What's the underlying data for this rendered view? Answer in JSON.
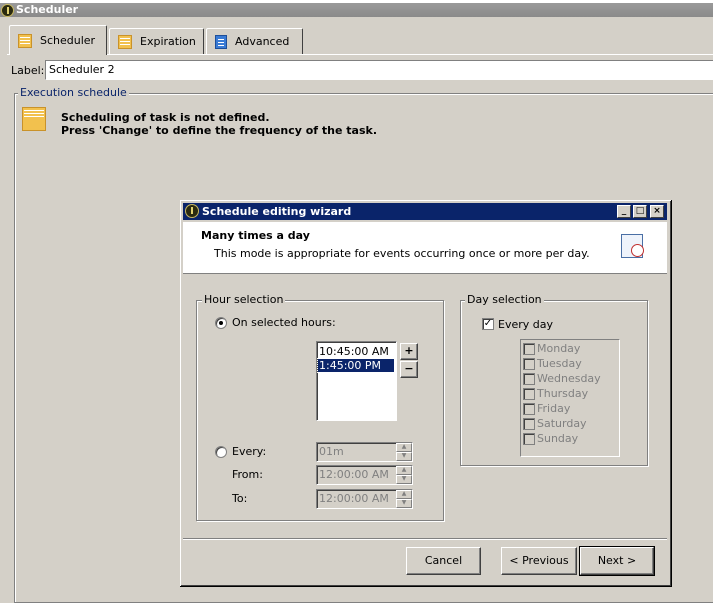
{
  "app": {
    "title": "Scheduler"
  },
  "tabs": [
    {
      "label": "Scheduler",
      "icon": "calendar-icon",
      "active": true
    },
    {
      "label": "Expiration",
      "icon": "calendar-icon",
      "active": false
    },
    {
      "label": "Advanced",
      "icon": "clipboard-icon",
      "active": false
    }
  ],
  "label_field": {
    "caption": "Label:",
    "value": "Scheduler 2"
  },
  "execution": {
    "legend": "Execution schedule",
    "message_line1": "Scheduling of task is not defined.",
    "message_line2": "Press 'Change' to define the frequency of the task."
  },
  "wizard": {
    "title": "Schedule editing wizard",
    "window_buttons": {
      "minimize": "_",
      "maximize": "□",
      "close": "×"
    },
    "mode_title": "Many times a day",
    "mode_description": "This mode is appropriate for events occurring once or more per day.",
    "hour_selection": {
      "legend": "Hour selection",
      "on_selected_label": "On selected hours:",
      "hours": [
        "10:45:00 AM",
        "1:45:00 PM"
      ],
      "selected_hour_index": 1,
      "add_button": "+",
      "remove_button": "−",
      "every_label": "Every:",
      "every_value": "01m",
      "from_label": "From:",
      "from_value": "12:00:00 AM",
      "to_label": "To:",
      "to_value": "12:00:00 AM"
    },
    "day_selection": {
      "legend": "Day selection",
      "every_day_label": "Every day",
      "every_day_checked": true,
      "days": [
        "Monday",
        "Tuesday",
        "Wednesday",
        "Thursday",
        "Friday",
        "Saturday",
        "Sunday"
      ]
    },
    "buttons": {
      "cancel": "Cancel",
      "previous": "< Previous",
      "next": "Next >"
    }
  },
  "colors": {
    "face": "#d4d0c8",
    "titlebar": "#0a246a",
    "selection": "#0a246a",
    "legend_text": "#0a246a"
  }
}
